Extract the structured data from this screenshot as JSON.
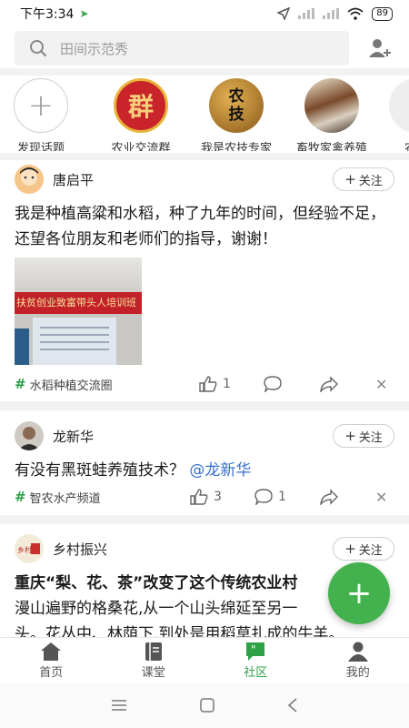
{
  "status": {
    "time": "下午3:34",
    "battery": "89"
  },
  "search": {
    "placeholder": "田间示范秀"
  },
  "topics": [
    {
      "label": "发现话题",
      "icon": "plus-icon"
    },
    {
      "label": "农业交流群",
      "icon_text": "群"
    },
    {
      "label": "我是农技专家",
      "icon_text_1": "农",
      "icon_text_2": "技"
    },
    {
      "label": "畜牧家禽养殖",
      "icon": "livestock-image"
    },
    {
      "label": "农资"
    }
  ],
  "posts": [
    {
      "author": "唐启平",
      "follow": "关注",
      "text": "我是种植高粱和水稻，种了九年的时间，但经验不足，还望各位朋友和老师们的指导，谢谢！",
      "image_banner": "扶贫创业致富带头人培训班",
      "tag": "水稻种植交流圈",
      "likes": "1",
      "comments": "",
      "shares": ""
    },
    {
      "author": "龙新华",
      "follow": "关注",
      "text": "有没有黑斑蛙养殖技术？",
      "mention": "@龙新华",
      "tag": "智农水产频道",
      "likes": "3",
      "comments": "1"
    },
    {
      "author": "乡村振兴",
      "follow": "关注",
      "title": "重庆“梨、花、茶”改变了这个传统农业村",
      "text_line1": "漫山遍野的格桑花,从一个山头绵延至另一",
      "text_line2": "头。花丛中、林荫下,到处是用稻草扎成的牛羊。"
    }
  ],
  "nav": [
    {
      "label": "首页",
      "icon": "home-icon"
    },
    {
      "label": "课堂",
      "icon": "book-icon"
    },
    {
      "label": "社区",
      "icon": "chat-icon",
      "active": true
    },
    {
      "label": "我的",
      "icon": "person-icon"
    }
  ],
  "colors": {
    "accent": "#2ea147",
    "fab": "#43b14d",
    "mention": "#3a6fd0"
  }
}
